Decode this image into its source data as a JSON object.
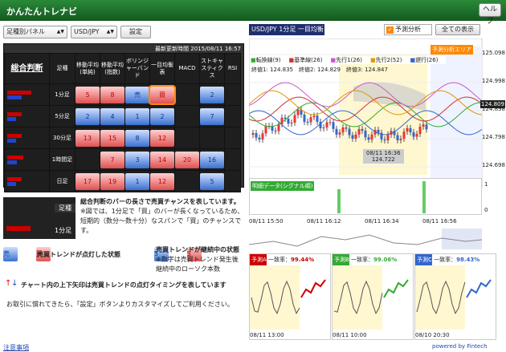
{
  "header": {
    "title": "かんたんトレナビ",
    "help": "ヘルプ"
  },
  "toolbar": {
    "panel_select": "足種別パネル",
    "pair_select": "USD/JPY",
    "settings": "設定"
  },
  "panel": {
    "update_label": "最新更新時間 2015/08/11 16:57",
    "headers": [
      "総合判断",
      "足種",
      "移動平均(単純)",
      "移動平均(指数)",
      "ボリンジャーバンド",
      "一目均衡表",
      "MACD",
      "ストキャスティクス",
      "RSI"
    ],
    "rows": [
      {
        "tf": "1分足",
        "cells": [
          {
            "d": "up",
            "v": "5"
          },
          {
            "d": "up",
            "v": "8"
          },
          {
            "d": "dn",
            "v": "売"
          },
          {
            "d": "hot",
            "v": "買"
          },
          {
            "d": "",
            "v": ""
          },
          {
            "d": "dn",
            "v": "2"
          },
          {
            "d": "",
            "v": ""
          }
        ]
      },
      {
        "tf": "5分足",
        "cells": [
          {
            "d": "dn",
            "v": "2"
          },
          {
            "d": "dn",
            "v": "4"
          },
          {
            "d": "dn",
            "v": "1"
          },
          {
            "d": "dn",
            "v": "2"
          },
          {
            "d": "",
            "v": ""
          },
          {
            "d": "dn",
            "v": "7"
          },
          {
            "d": "",
            "v": ""
          }
        ]
      },
      {
        "tf": "30分足",
        "cells": [
          {
            "d": "up",
            "v": "13"
          },
          {
            "d": "up",
            "v": "15"
          },
          {
            "d": "dn",
            "v": "8"
          },
          {
            "d": "up",
            "v": "12"
          },
          {
            "d": "",
            "v": ""
          },
          {
            "d": "",
            "v": ""
          },
          {
            "d": "",
            "v": ""
          }
        ]
      },
      {
        "tf": "1時間足",
        "cells": [
          {
            "d": "",
            "v": ""
          },
          {
            "d": "up",
            "v": "7"
          },
          {
            "d": "dn",
            "v": "3"
          },
          {
            "d": "up",
            "v": "14"
          },
          {
            "d": "up",
            "v": "20"
          },
          {
            "d": "dn",
            "v": "16"
          },
          {
            "d": "",
            "v": ""
          }
        ]
      },
      {
        "tf": "日足",
        "cells": [
          {
            "d": "up",
            "v": "17"
          },
          {
            "d": "up",
            "v": "19"
          },
          {
            "d": "dn",
            "v": "1"
          },
          {
            "d": "up",
            "v": "12"
          },
          {
            "d": "",
            "v": ""
          },
          {
            "d": "dn",
            "v": "5"
          },
          {
            "d": "",
            "v": ""
          }
        ]
      }
    ],
    "bars": [
      [
        30,
        0
      ],
      [
        18,
        0
      ],
      [
        18,
        0
      ],
      [
        20,
        0
      ],
      [
        18,
        0
      ]
    ]
  },
  "explain": {
    "label": "総合判断",
    "col": "足種",
    "tf": "1分足",
    "title_text": "総合判断のバーの長さで売買チャンスを表しています。",
    "note1": "※図では、1分足で「買」のバーが長くなっているため、",
    "note2": "短期的（数分〜数十分）なスパンで「買」のチャンスで",
    "note3": "す。",
    "lit": "売買トレンドが点灯した状態",
    "cont": "売買トレンドが継続中の状態",
    "cont2": "※数字は売買トレンド発生後",
    "cont3": "継続中のローソク本数",
    "arrow": "チャート内の上下矢印は売買トレンドの点灯タイミングを表しています",
    "custom": "お取引に慣れてきたら、「設定」ボタンよりカスタマイズしてご利用ください。",
    "lit_num": "5",
    "cont_num": "5",
    "lit_sell": "売",
    "lit_buy": "買",
    "cont_n1": "5"
  },
  "chart": {
    "title": "USD/JPY 1分足 一目均衡表",
    "forecast": "予測分析",
    "all": "全ての表示",
    "legend": [
      "転換線(9)",
      "基準線(26)",
      "先行1(26)",
      "先行2(52)",
      "遅行(26)"
    ],
    "legend_colors": [
      "#3a3",
      "#c33",
      "#c5c",
      "#d90",
      "#36c"
    ],
    "closes": "終値1: 124.835　終値2: 124.829　終値3: 124.847",
    "yaxis": [
      "125.098",
      "124.998",
      "124.898",
      "124.798",
      "124.698"
    ],
    "price_tag": "124.809",
    "forecast_area": "予測分析エリア",
    "tooltip_time": "08/11 16:36",
    "tooltip_val": "124.722",
    "xaxis": [
      "08/11 15:50",
      "08/11 16:12",
      "08/11 16:34",
      "08/11 16:56"
    ],
    "signal_label": "明細データ(シグナル順)",
    "signal_y": [
      "1",
      "0"
    ],
    "preds": [
      {
        "name": "予測A",
        "rate_label": "一致率：",
        "rate": "99.44%",
        "color": "#c00",
        "y": [
          "124.740",
          "124.720",
          "124.700",
          "124.680",
          "124.660",
          "124.640",
          "124.620"
        ],
        "x": "08/11 13:00"
      },
      {
        "name": "予測B",
        "rate_label": "一致率：",
        "rate": "99.06%",
        "color": "#3a3",
        "y": [
          "124.600",
          "124.620",
          "124.660",
          "124.700"
        ],
        "x": "08/11 10:00"
      },
      {
        "name": "予測C",
        "rate_label": "一致率：",
        "rate": "98.43%",
        "color": "#36c",
        "y": [
          "124.690",
          "124.670",
          "124.650",
          "124.630"
        ],
        "x": "08/10 20:30"
      }
    ]
  },
  "footer": {
    "note": "注意事項",
    "powered": "powered by Fintech"
  }
}
